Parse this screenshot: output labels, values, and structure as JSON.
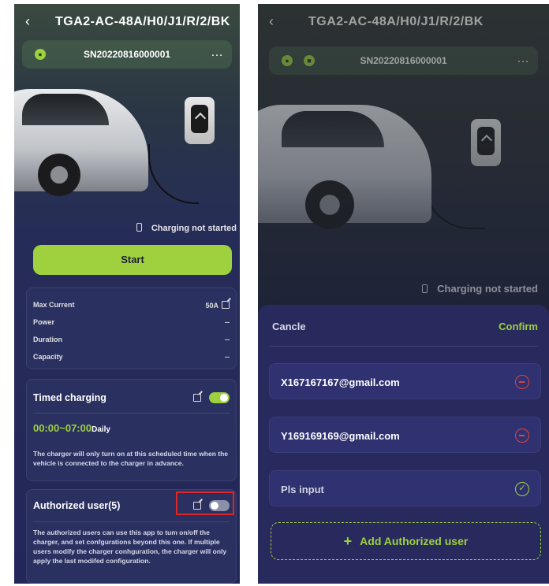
{
  "app": {
    "title": "TGA2-AC-48A/H0/J1/R/2/BK",
    "serial": "SN20220816000001",
    "more_icon": "…"
  },
  "status": {
    "charging": "Charging not started"
  },
  "left": {
    "start_label": "Start",
    "metrics": [
      {
        "label": "Max Current",
        "value": "50A"
      },
      {
        "label": "Power",
        "value": "--"
      },
      {
        "label": "Duration",
        "value": "--"
      },
      {
        "label": "Capacity",
        "value": "--"
      }
    ],
    "timed": {
      "title": "Timed charging",
      "enabled": true,
      "time": "00:00~07:00",
      "repeat": "Daily",
      "description": "The charger will only turn on at this scheduled time when the vehicle is connected to the charger in advance."
    },
    "authorized": {
      "title": "Authorized user(5)",
      "enabled": false,
      "description": "The authorized users can use this app to tum on/off the charger, and set confgurations beyond this one. If multiple users modify the charger conhguration, the charger will only apply the last modifed configuration."
    }
  },
  "right": {
    "cancel_label": "Cancle",
    "confirm_label": "Confirm",
    "users": [
      "X167167167@gmail.com",
      "Y169169169@gmail.com"
    ],
    "input_placeholder": "Pls input",
    "add_label": "Add Authorized user"
  },
  "colors": {
    "accent": "#9fd13f",
    "danger": "#e0443c",
    "highlight": "#e02626"
  }
}
